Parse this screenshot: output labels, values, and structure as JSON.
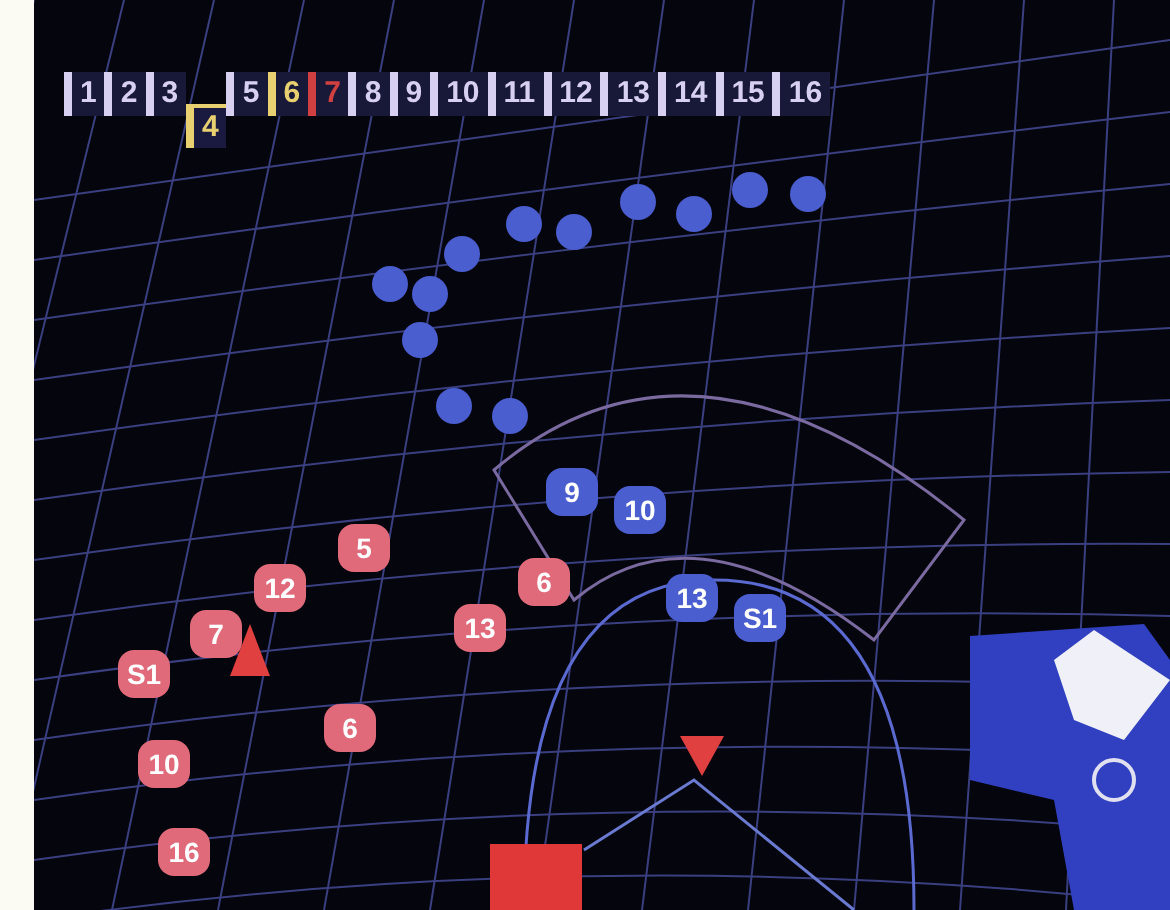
{
  "number_bar": [
    {
      "label": "1",
      "color": "#d8d0f0",
      "selected": false
    },
    {
      "label": "2",
      "color": "#d8d0f0",
      "selected": false
    },
    {
      "label": "3",
      "color": "#d8d0f0",
      "selected": false
    },
    {
      "label": "4",
      "color": "#e8d070",
      "selected": true
    },
    {
      "label": "5",
      "color": "#d8d0f0",
      "selected": false
    },
    {
      "label": "6",
      "color": "#e8d070",
      "selected": false
    },
    {
      "label": "7",
      "color": "#d04040",
      "selected": false
    },
    {
      "label": "8",
      "color": "#d8d0f0",
      "selected": false
    },
    {
      "label": "9",
      "color": "#d8d0f0",
      "selected": false
    },
    {
      "label": "10",
      "color": "#d8d0f0",
      "selected": false
    },
    {
      "label": "11",
      "color": "#d8d0f0",
      "selected": false
    },
    {
      "label": "12",
      "color": "#d8d0f0",
      "selected": false
    },
    {
      "label": "13",
      "color": "#d8d0f0",
      "selected": false
    },
    {
      "label": "14",
      "color": "#d8d0f0",
      "selected": false
    },
    {
      "label": "15",
      "color": "#d8d0f0",
      "selected": false
    },
    {
      "label": "16",
      "color": "#d8d0f0",
      "selected": false
    }
  ],
  "tokens": [
    {
      "label": "9",
      "color": "#4a5ed0"
    },
    {
      "label": "10",
      "color": "#4a5ed0"
    },
    {
      "label": "13",
      "color": "#4a5ed0"
    },
    {
      "label": "S1",
      "color": "#4a5ed0"
    },
    {
      "label": "5",
      "color": "#e06a7a"
    },
    {
      "label": "12",
      "color": "#e06a7a"
    },
    {
      "label": "7",
      "color": "#e06a7a"
    },
    {
      "label": "S1",
      "color": "#e06a7a"
    },
    {
      "label": "10",
      "color": "#e06a7a"
    },
    {
      "label": "16",
      "color": "#e06a7a"
    },
    {
      "label": "13",
      "color": "#e06a7a"
    },
    {
      "label": "6",
      "color": "#e06a7a"
    },
    {
      "label": "6",
      "color": "#e06a7a"
    }
  ]
}
